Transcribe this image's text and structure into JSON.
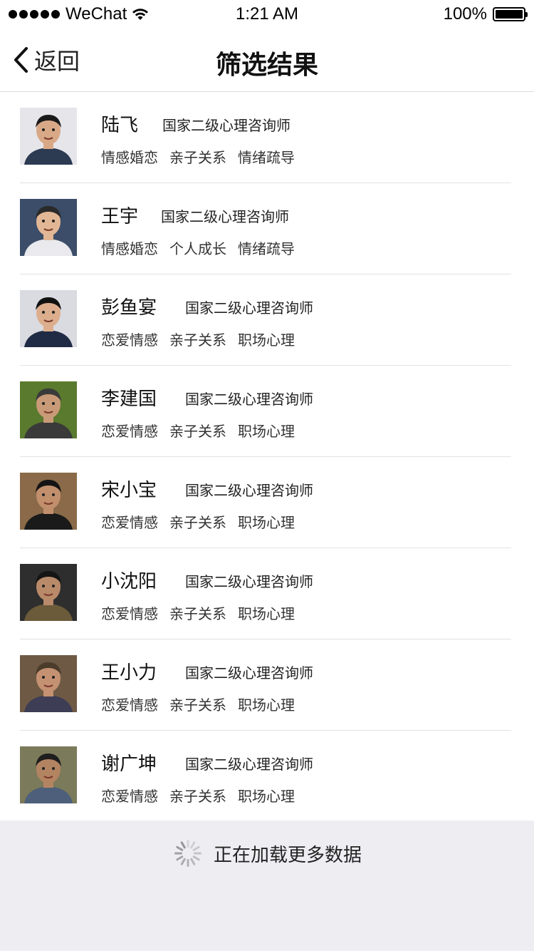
{
  "status_bar": {
    "carrier": "WeChat",
    "time": "1:21 AM",
    "battery": "100%",
    "battery_level": 1.0
  },
  "nav": {
    "back_label": "返回",
    "title": "筛选结果"
  },
  "counselors": [
    {
      "name": "陆飞",
      "title": "国家二级心理咨询师",
      "tags": [
        "情感婚恋",
        "亲子关系",
        "情绪疏导"
      ]
    },
    {
      "name": "王宇",
      "title": "国家二级心理咨询师",
      "tags": [
        "情感婚恋",
        "个人成长",
        "情绪疏导"
      ]
    },
    {
      "name": "彭鱼宴",
      "title": "国家二级心理咨询师",
      "tags": [
        "恋爱情感",
        "亲子关系",
        "职场心理"
      ]
    },
    {
      "name": "李建国",
      "title": "国家二级心理咨询师",
      "tags": [
        "恋爱情感",
        "亲子关系",
        "职场心理"
      ]
    },
    {
      "name": "宋小宝",
      "title": "国家二级心理咨询师",
      "tags": [
        "恋爱情感",
        "亲子关系",
        "职场心理"
      ]
    },
    {
      "name": "小沈阳",
      "title": "国家二级心理咨询师",
      "tags": [
        "恋爱情感",
        "亲子关系",
        "职场心理"
      ]
    },
    {
      "name": "王小力",
      "title": "国家二级心理咨询师",
      "tags": [
        "恋爱情感",
        "亲子关系",
        "职场心理"
      ]
    },
    {
      "name": "谢广坤",
      "title": "国家二级心理咨询师",
      "tags": [
        "恋爱情感",
        "亲子关系",
        "职场心理"
      ]
    }
  ],
  "footer": {
    "loading_text": "正在加载更多数据"
  },
  "icons": {
    "back": "chevron-left-icon",
    "wifi": "wifi-icon",
    "battery": "battery-icon",
    "spinner": "loading-spinner-icon"
  },
  "colors": {
    "footer_bg": "#eeedf2",
    "divider": "#e2e2e2"
  }
}
